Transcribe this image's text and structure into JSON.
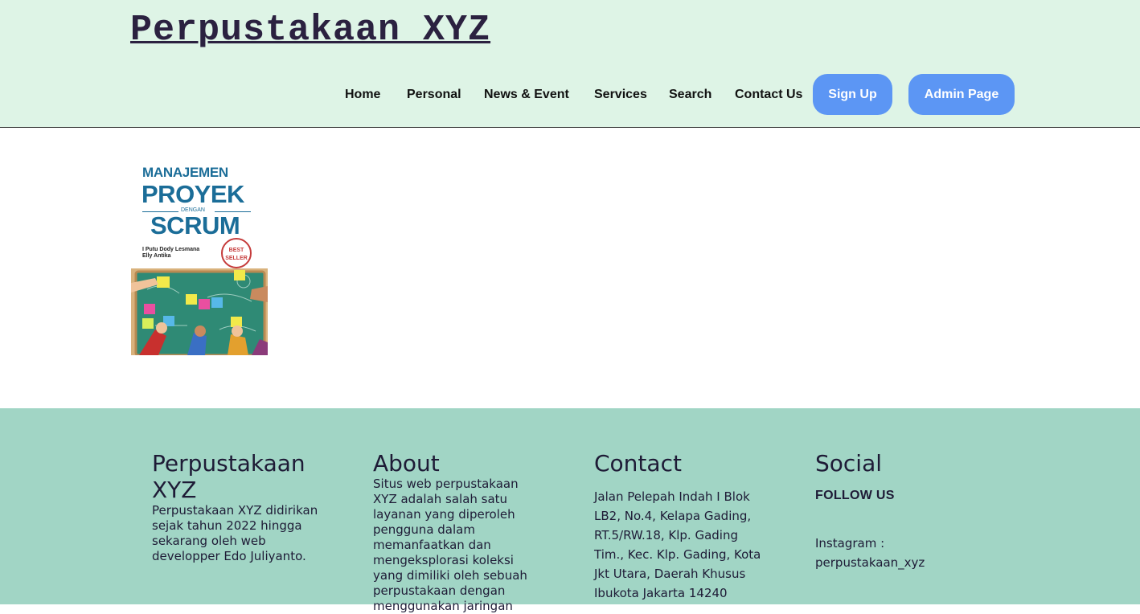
{
  "header": {
    "title": "Perpustakaan XYZ",
    "nav": [
      "Home",
      "Personal",
      "News & Event",
      "Services",
      "Search",
      "Contact Us"
    ],
    "signup_label": "Sign Up",
    "admin_label": "Admin Page"
  },
  "book": {
    "line1": "MANAJEMEN",
    "line2": "PROYEK",
    "line3": "DENGAN",
    "line4": "SCRUM",
    "author1": "I Putu Dody Lesmana",
    "author2": "Elly Antika",
    "seal": "BEST SELLER"
  },
  "footer": {
    "brand": {
      "title": "Perpustakaan XYZ",
      "text": "Perpustakaan XYZ didirikan sejak tahun 2022 hingga sekarang oleh web developper Edo Juliyanto."
    },
    "about": {
      "title": "About",
      "text": "Situs web perpustakaan XYZ adalah salah satu layanan yang diperoleh pengguna dalam memanfaatkan dan mengeksplorasi koleksi yang dimiliki oleh sebuah perpustakaan dengan menggunakan jaringan"
    },
    "contact": {
      "title": "Contact",
      "text": "Jalan Pelepah Indah I Blok LB2, No.4, Kelapa Gading, RT.5/RW.18, Klp. Gading Tim., Kec. Klp. Gading, Kota Jkt Utara, Daerah Khusus Ibukota Jakarta 14240"
    },
    "social": {
      "title": "Social",
      "follow": "FOLLOW US",
      "instagram": "Instagram : perpustakaan_xyz"
    }
  },
  "colors": {
    "header_bg": "#def4e6",
    "footer_bg": "#a1d5c5",
    "button_bg": "#5c96f4",
    "title_color": "#2b2140"
  }
}
